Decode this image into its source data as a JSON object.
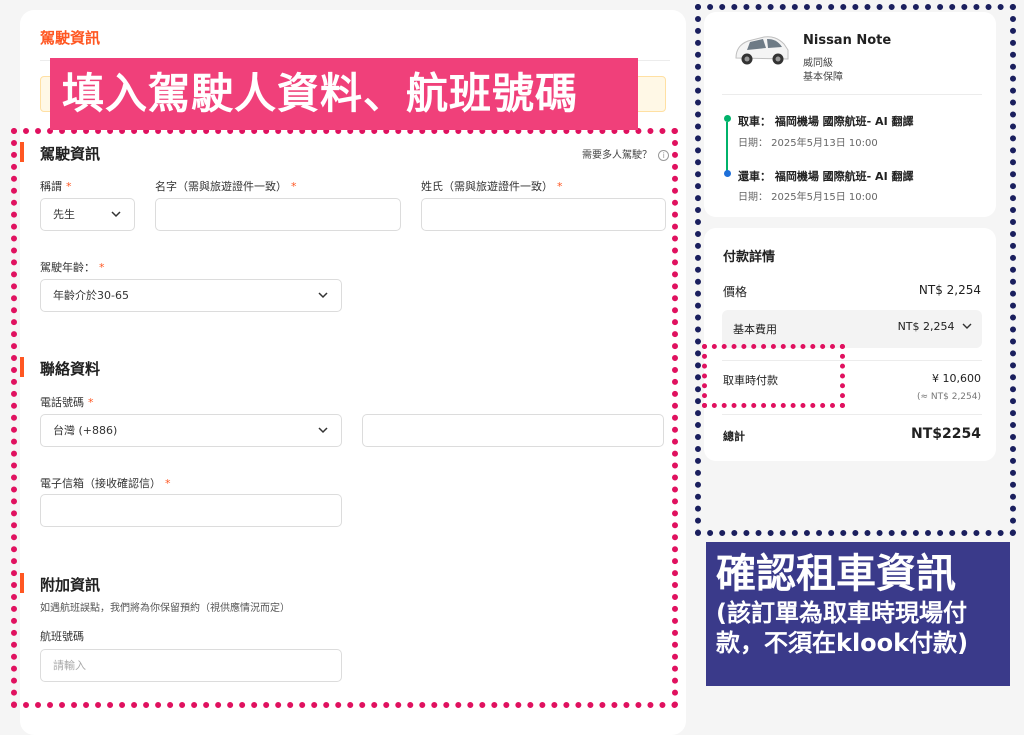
{
  "page": {
    "top_title": "駕駛資訊",
    "banner": "填入駕駛人資料、航班號碼"
  },
  "driver": {
    "section_title": "駕駛資訊",
    "multi_driver_link": "需要多人駕駛？",
    "title_label": "稱謂",
    "title_value": "先生",
    "first_name_label": "名字（需與旅遊證件一致）",
    "last_name_label": "姓氏（需與旅遊證件一致）",
    "age_label": "駕駛年齡：",
    "age_value": "年齡介於30-65",
    "required_mark": "*"
  },
  "contact": {
    "section_title": "聯絡資料",
    "phone_label": "電話號碼",
    "phone_country": "台灣 (+886)",
    "email_label": "電子信箱（接收確認信）"
  },
  "extra": {
    "section_title": "附加資訊",
    "note": "如遇航班誤點，我們將為你保留預約（視供應情況而定）",
    "flight_label": "航班號碼",
    "flight_placeholder": "請輸入"
  },
  "car": {
    "name": "Nissan Note",
    "class": "威同級",
    "protection": "基本保障",
    "pickup_loc": "取車： 福岡機場 國際航班- AI 翻譯",
    "pickup_date": "日期： 2025年5月13日 10:00",
    "return_loc": "還車： 福岡機場 國際航班- AI 翻譯",
    "return_date": "日期： 2025年5月15日 10:00"
  },
  "payment": {
    "title": "付款詳情",
    "price_label": "價格",
    "price_value": "NT$ 2,254",
    "basic_label": "基本費用",
    "basic_value": "NT$ 2,254",
    "pay_at_pickup_label": "取車時付款",
    "pay_at_pickup_value": "¥ 10,600",
    "pay_at_pickup_approx": "(≈ NT$ 2,254)",
    "total_label": "總計",
    "total_value": "NT$2254"
  },
  "annotation": {
    "title": "確認租車資訊",
    "sub": "(該訂單為取車時現場付款，不須在klook付款)"
  },
  "colors": {
    "accent": "#ff5722",
    "banner_pink": "#f0407a",
    "dotted_pink": "#e0115f",
    "dotted_navy": "#1a1f5e",
    "navy_box": "#3a3a8a",
    "pickup_dot": "#00b26a",
    "return_dot": "#1e6fd9"
  },
  "icons": [
    "chevron-down-icon",
    "info-icon",
    "car-photo"
  ]
}
